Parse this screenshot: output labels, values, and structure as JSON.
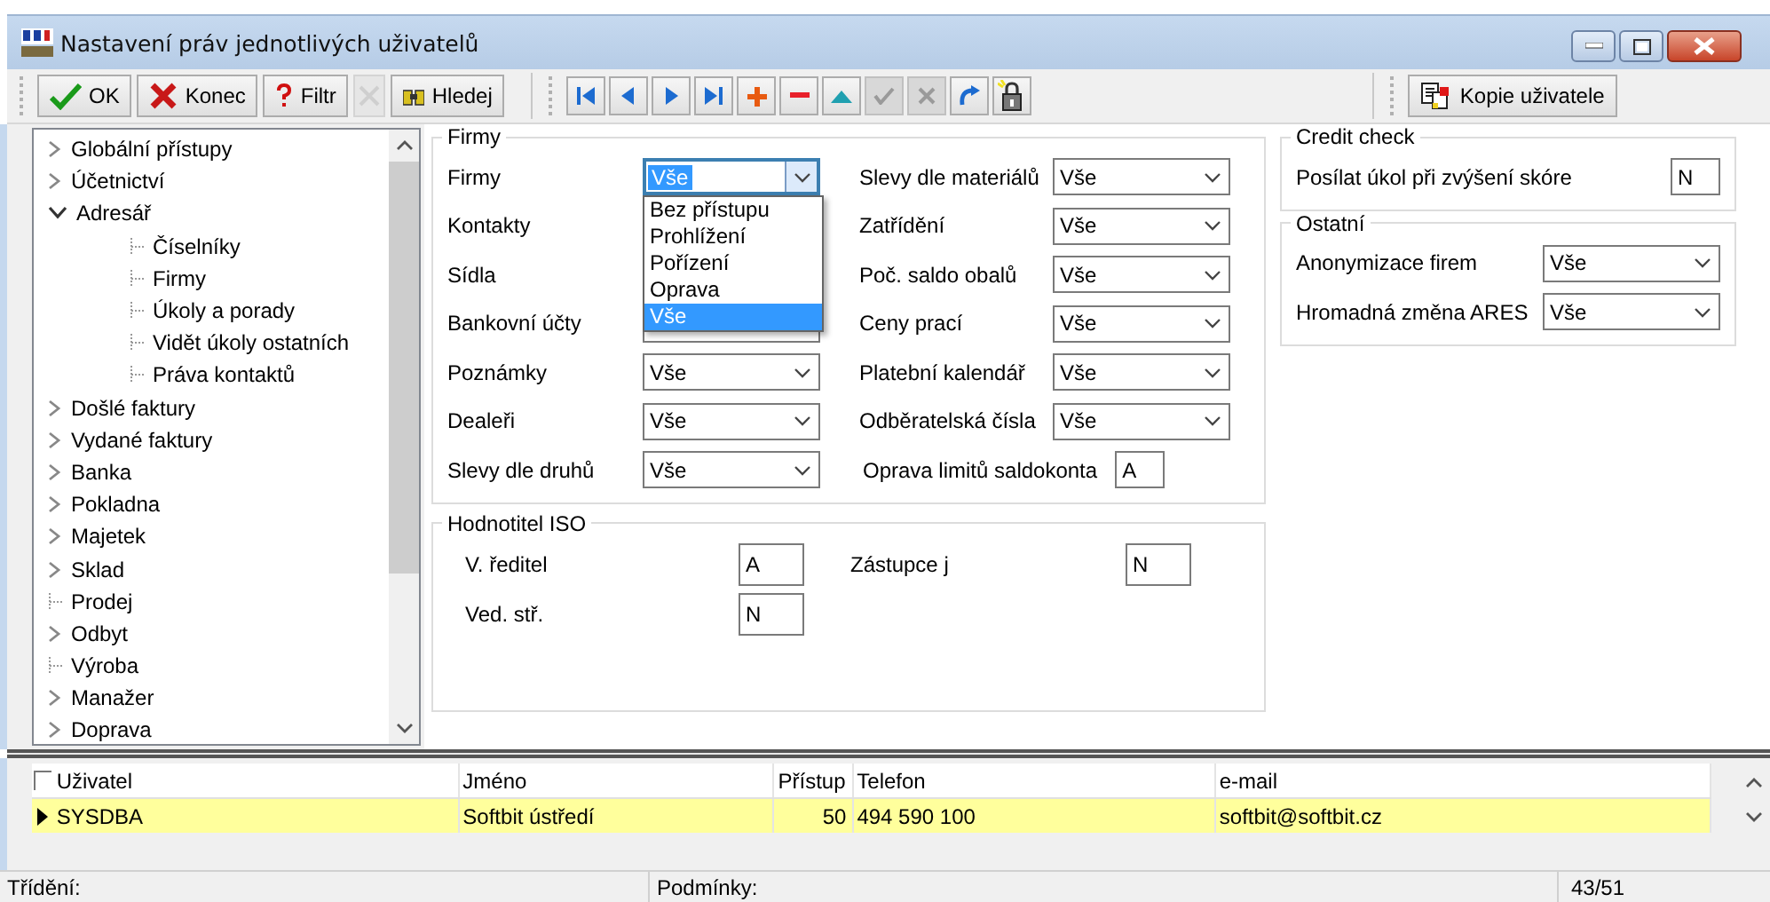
{
  "window": {
    "title": "Nastavení práv jednotlivých uživatelů"
  },
  "toolbar": {
    "left": [
      {
        "label": "OK",
        "kind": "check",
        "disabled": false
      },
      {
        "label": "Konec",
        "kind": "cross",
        "disabled": false
      },
      {
        "label": "Filtr",
        "kind": "question",
        "disabled": false
      },
      {
        "kind": "blank",
        "disabled": true
      },
      {
        "label": "Hledej",
        "kind": "binoculars",
        "disabled": false
      }
    ],
    "nav": [
      {
        "kind": "first",
        "disabled": false
      },
      {
        "kind": "prev",
        "disabled": false
      },
      {
        "kind": "next",
        "disabled": false
      },
      {
        "kind": "last",
        "disabled": false
      },
      {
        "kind": "add",
        "disabled": false
      },
      {
        "kind": "remove",
        "disabled": false
      },
      {
        "kind": "up",
        "disabled": false
      },
      {
        "kind": "confirm",
        "disabled": true
      },
      {
        "kind": "cancel",
        "disabled": true
      },
      {
        "kind": "refresh",
        "disabled": false
      },
      {
        "kind": "lock",
        "disabled": false
      }
    ],
    "right": [
      {
        "label": "Kopie uživatele",
        "kind": "copy",
        "disabled": false
      }
    ]
  },
  "tree": [
    {
      "label": "Globální přístupy",
      "kind": "folder",
      "expanded": false
    },
    {
      "label": "Účetnictví",
      "kind": "folder",
      "expanded": false
    },
    {
      "label": "Adresář",
      "kind": "folder",
      "expanded": true,
      "children": [
        {
          "label": "Číselníky",
          "kind": "leaf"
        },
        {
          "label": "Firmy",
          "kind": "leaf"
        },
        {
          "label": "Úkoly a porady",
          "kind": "leaf"
        },
        {
          "label": "Vidět úkoly ostatních",
          "kind": "leaf"
        },
        {
          "label": "Práva kontaktů",
          "kind": "leaf"
        }
      ]
    },
    {
      "label": "Došlé faktury",
      "kind": "folder",
      "expanded": false
    },
    {
      "label": "Vydané faktury",
      "kind": "folder",
      "expanded": false
    },
    {
      "label": "Banka",
      "kind": "folder",
      "expanded": false
    },
    {
      "label": "Pokladna",
      "kind": "folder",
      "expanded": false
    },
    {
      "label": "Majetek",
      "kind": "folder",
      "expanded": false
    },
    {
      "label": "Sklad",
      "kind": "folder",
      "expanded": false
    },
    {
      "label": "Prodej",
      "kind": "leaf"
    },
    {
      "label": "Odbyt",
      "kind": "folder",
      "expanded": false
    },
    {
      "label": "Výroba",
      "kind": "leaf"
    },
    {
      "label": "Manažer",
      "kind": "folder",
      "expanded": false
    },
    {
      "label": "Doprava",
      "kind": "folder",
      "expanded": false
    }
  ],
  "firmy_group": {
    "title": "Firmy",
    "columns": [
      [
        {
          "label": "Firmy",
          "kind": "select",
          "value": "Vše",
          "options": [
            {
              "label": "Bez přístupu",
              "selected": false
            },
            {
              "label": "Prohlížení",
              "selected": false
            },
            {
              "label": "Pořízení",
              "selected": false
            },
            {
              "label": "Oprava",
              "selected": false
            },
            {
              "label": "Vše",
              "selected": true
            }
          ]
        },
        {
          "label": "Kontakty",
          "kind": "covered"
        },
        {
          "label": "Sídla",
          "kind": "covered"
        },
        {
          "label": "Bankovní účty",
          "kind": "select"
        },
        {
          "label": "Poznámky",
          "kind": "select",
          "value": "Vše"
        },
        {
          "label": "Dealeři",
          "kind": "select",
          "value": "Vše"
        },
        {
          "label": "Slevy dle druhů",
          "kind": "select",
          "value": "Vše"
        }
      ],
      [
        {
          "label": "Slevy dle materiálů",
          "kind": "select",
          "value": "Vše"
        },
        {
          "label": "Zatřídění",
          "kind": "select",
          "value": "Vše"
        },
        {
          "label": "Poč. saldo obalů",
          "kind": "select",
          "value": "Vše"
        },
        {
          "label": "Ceny prací",
          "kind": "select",
          "value": "Vše"
        },
        {
          "label": "Platební kalendář",
          "kind": "select",
          "value": "Vše"
        },
        {
          "label": "Odběratelská čísla",
          "kind": "select",
          "value": "Vše"
        },
        {
          "label": "Oprava limitů saldokonta",
          "kind": "text",
          "value": "A"
        }
      ]
    ]
  },
  "iso_group": {
    "title": "Hodnotitel ISO",
    "fields": [
      {
        "label": "V. ředitel",
        "value": "A"
      },
      {
        "label": "Zástupce j",
        "value": "N"
      },
      {
        "label": "Ved. stř.",
        "value": "N"
      }
    ]
  },
  "credit_group": {
    "title": "Credit check",
    "fields": [
      {
        "label": "Posílat úkol při zvýšení skóre",
        "kind": "text",
        "value": "N"
      }
    ]
  },
  "other_group": {
    "title": "Ostatní",
    "fields": [
      {
        "label": "Anonymizace firem",
        "kind": "select",
        "value": "Vše"
      },
      {
        "label": "Hromadná změna ARES",
        "kind": "select",
        "value": "Vše"
      }
    ]
  },
  "table": {
    "all_checked": false,
    "columns": [
      "Uživatel",
      "Jméno",
      "Přístup",
      "Telefon",
      "e-mail"
    ],
    "rows": [
      {
        "cells": [
          "SYSDBA",
          "Softbit ústředí",
          "50",
          "494 590 100",
          "softbit@softbit.cz"
        ],
        "selected": true
      }
    ]
  },
  "status_bar": {
    "sorting": "Třídění:",
    "conditions": "Podmínky:",
    "position": "43/51"
  }
}
